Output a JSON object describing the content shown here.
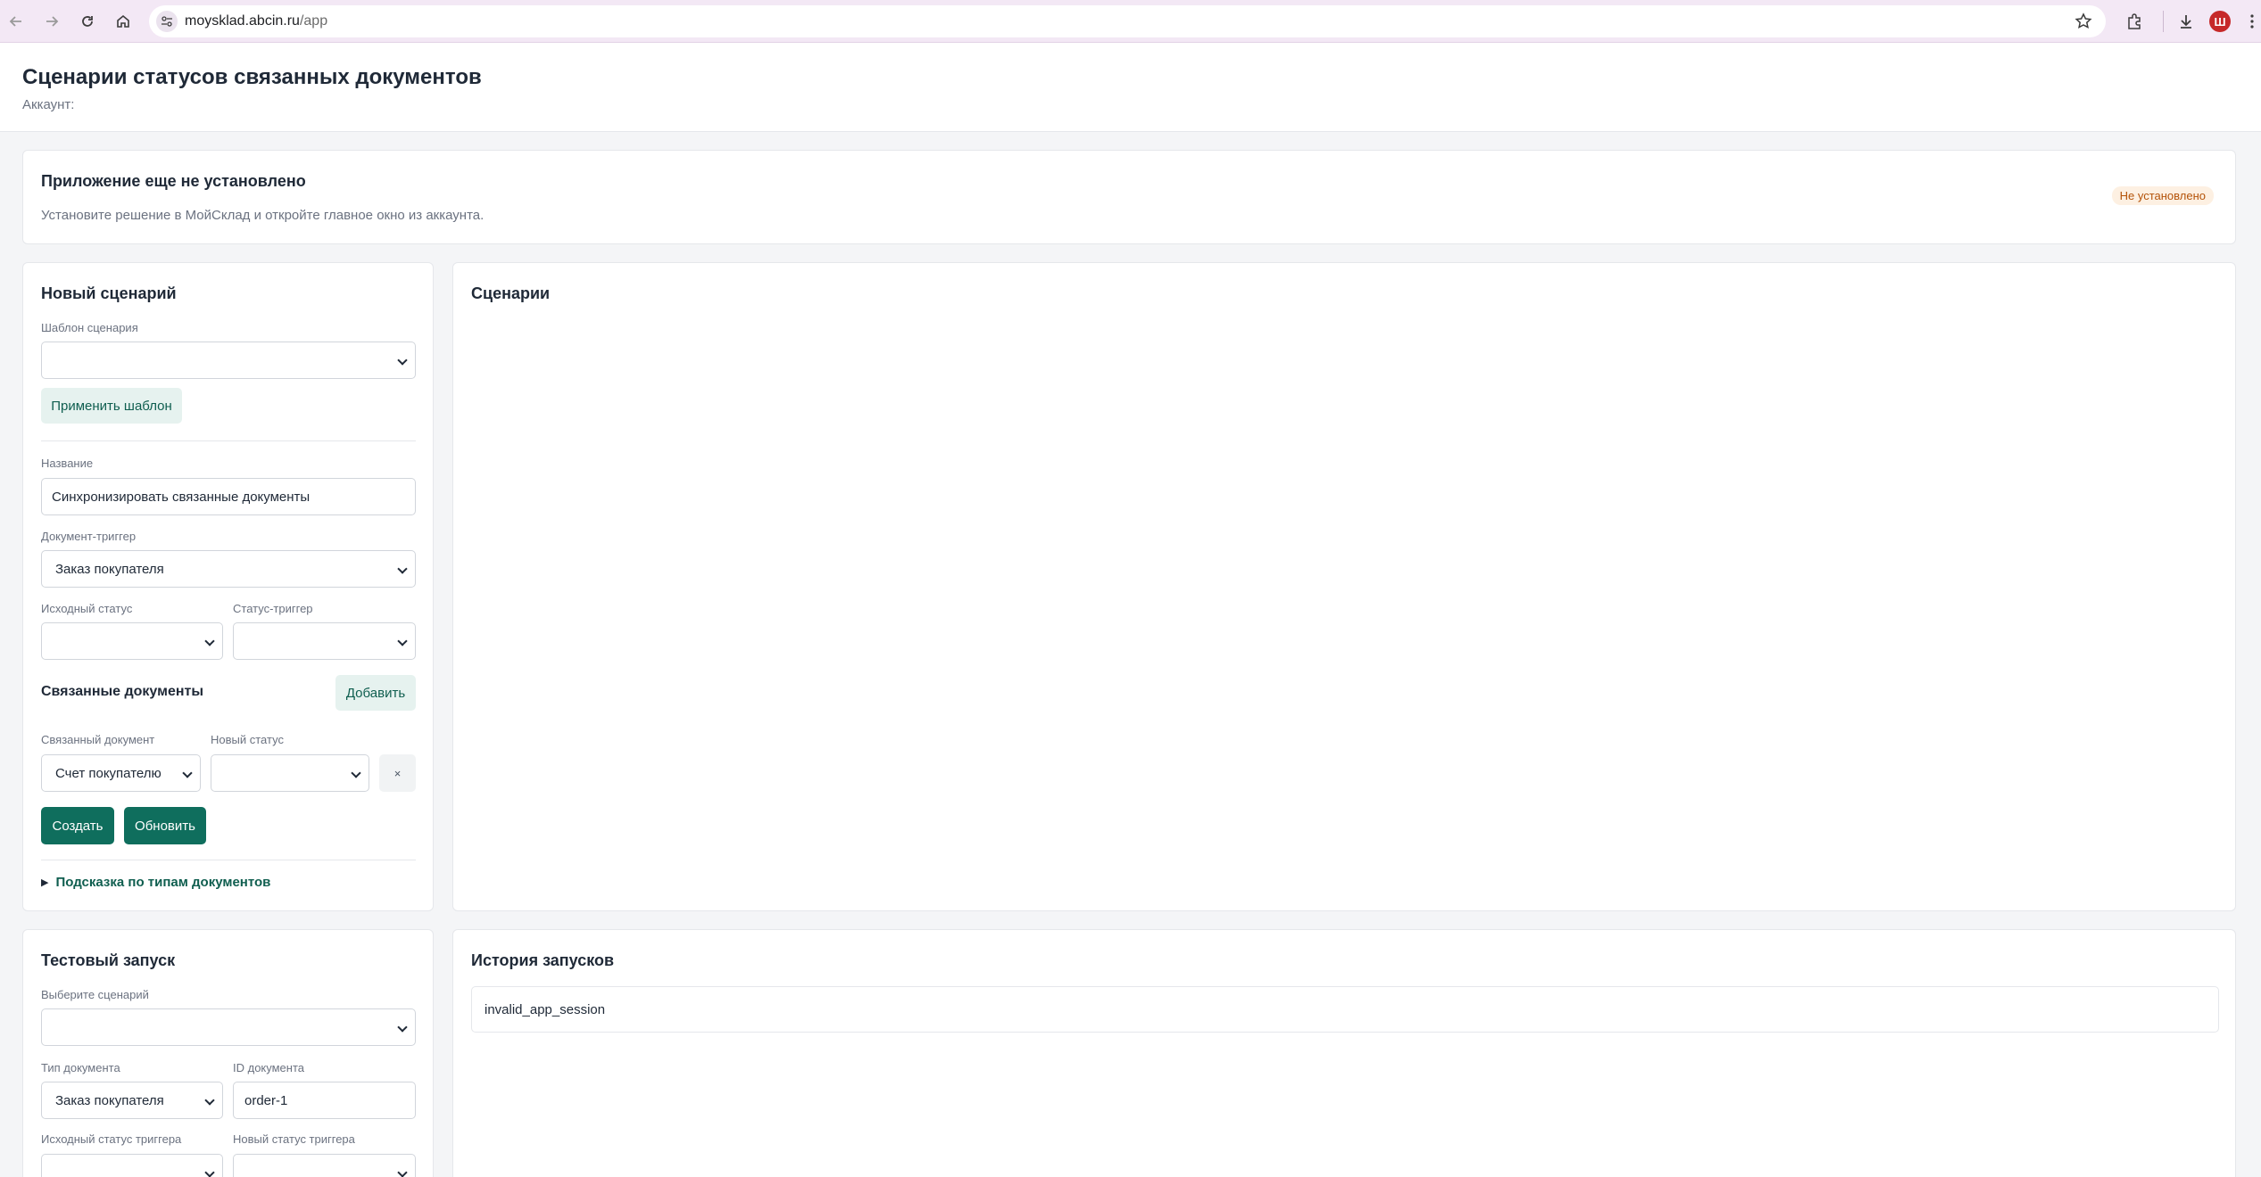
{
  "browser": {
    "url_host": "moysklad.abcin.ru",
    "url_path": "/app",
    "profile_initial": "Ш"
  },
  "header": {
    "title": "Сценарии статусов связанных документов",
    "account_label": "Аккаунт:"
  },
  "install_notice": {
    "title": "Приложение еще не установлено",
    "text": "Установите решение в МойСклад и откройте главное окно из аккаунта.",
    "status_badge": "Не установлено"
  },
  "new_scenario": {
    "title": "Новый сценарий",
    "template_label": "Шаблон сценария",
    "template_value": "",
    "apply_template_button": "Применить шаблон",
    "name_label": "Название",
    "name_value": "Синхронизировать связанные документы",
    "trigger_doc_label": "Документ-триггер",
    "trigger_doc_value": "Заказ покупателя",
    "source_status_label": "Исходный статус",
    "source_status_value": "",
    "trigger_status_label": "Статус-триггер",
    "trigger_status_value": "",
    "linked_docs_title": "Связанные документы",
    "add_button": "Добавить",
    "linked_doc_label": "Связанный документ",
    "linked_doc_value": "Счет покупателю",
    "new_status_label": "Новый статус",
    "new_status_value": "",
    "remove_button": "×",
    "create_button": "Создать",
    "update_button": "Обновить",
    "hint_toggle": "Подсказка по типам документов"
  },
  "scenarios": {
    "title": "Сценарии"
  },
  "test_run": {
    "title": "Тестовый запуск",
    "scenario_label": "Выберите сценарий",
    "scenario_value": "",
    "doc_type_label": "Тип документа",
    "doc_type_value": "Заказ покупателя",
    "doc_id_label": "ID документа",
    "doc_id_value": "order-1",
    "src_trigger_status_label": "Исходный статус триггера",
    "new_trigger_status_label": "Новый статус триггера"
  },
  "history": {
    "title": "История запусков",
    "entries": [
      "invalid_app_session"
    ]
  },
  "colors": {
    "accent": "#0f6e5d",
    "accent_light": "#e6f2ef",
    "badge_bg": "#fdf0e2",
    "badge_text": "#b45309",
    "chrome_bg": "#f3e8f5"
  }
}
